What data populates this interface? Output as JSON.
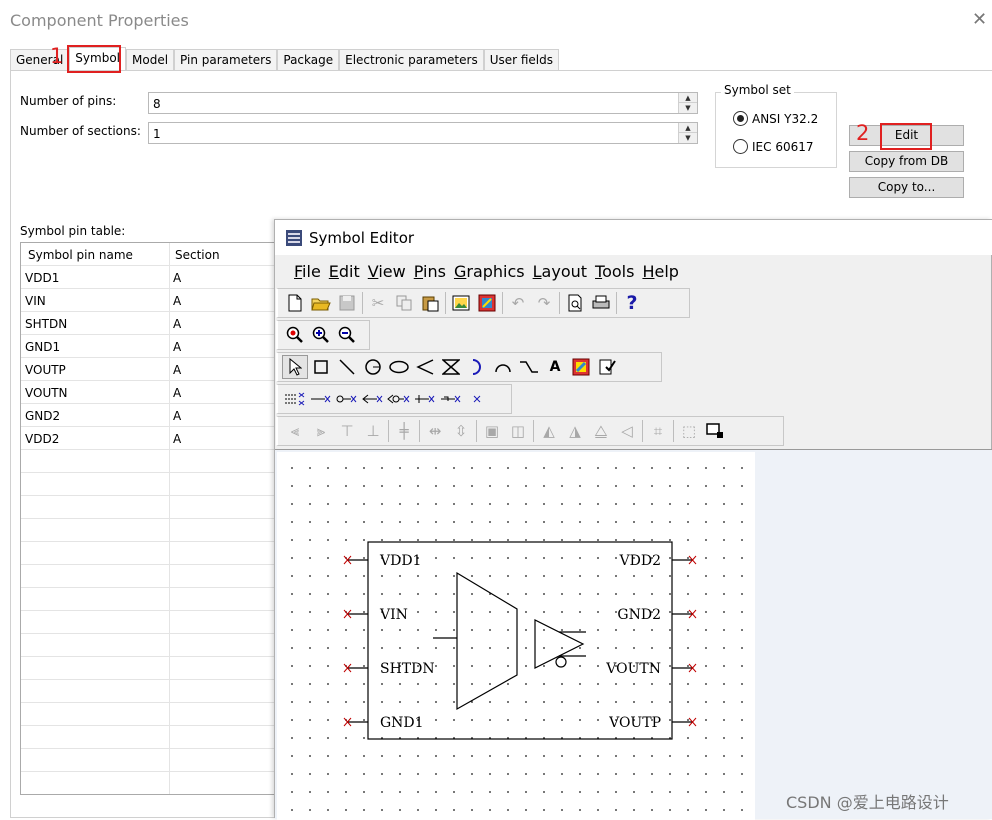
{
  "dialog": {
    "title": "Component Properties",
    "close": "✕",
    "tabs": [
      "General",
      "Symbol",
      "Model",
      "Pin parameters",
      "Package",
      "Electronic parameters",
      "User fields"
    ],
    "number_of_pins_label": "Number of pins:",
    "number_of_pins_value": "8",
    "number_of_sections_label": "Number of sections:",
    "number_of_sections_value": "1",
    "symbol_set": {
      "title": "Symbol set",
      "options": [
        "ANSI Y32.2",
        "IEC 60617"
      ],
      "selected": "ANSI Y32.2"
    },
    "buttons": {
      "edit": "Edit",
      "copy_from_db": "Copy from DB",
      "copy_to": "Copy to..."
    },
    "annotations": {
      "step1": "1",
      "step2": "2",
      "highlight_color": "#e02020"
    },
    "pin_table": {
      "label": "Symbol pin table:",
      "columns": [
        "Symbol pin name",
        "Section"
      ],
      "rows": [
        [
          "VDD1",
          "A"
        ],
        [
          "VIN",
          "A"
        ],
        [
          "SHTDN",
          "A"
        ],
        [
          "GND1",
          "A"
        ],
        [
          "VOUTP",
          "A"
        ],
        [
          "VOUTN",
          "A"
        ],
        [
          "GND2",
          "A"
        ],
        [
          "VDD2",
          "A"
        ]
      ]
    }
  },
  "symbol_editor": {
    "title": "Symbol Editor",
    "menu": [
      {
        "label": "File",
        "key": "F",
        "rest": "ile"
      },
      {
        "label": "Edit",
        "key": "E",
        "rest": "dit"
      },
      {
        "label": "View",
        "key": "V",
        "rest": "iew"
      },
      {
        "label": "Pins",
        "key": "P",
        "rest": "ins"
      },
      {
        "label": "Graphics",
        "key": "G",
        "rest": "raphics"
      },
      {
        "label": "Layout",
        "key": "L",
        "rest": "ayout"
      },
      {
        "label": "Tools",
        "key": "T",
        "rest": "ools"
      },
      {
        "label": "Help",
        "key": "H",
        "rest": "elp"
      }
    ],
    "icons": {
      "row1": [
        "new-file-icon",
        "open-folder-icon",
        "save-icon",
        "cut-icon",
        "copy-icon",
        "paste-icon",
        "import-image-icon",
        "properties-icon",
        "undo-icon",
        "redo-icon",
        "print-preview-icon",
        "print-icon",
        "help-icon"
      ],
      "row2": [
        "zoom-area-icon",
        "zoom-in-icon",
        "zoom-out-icon"
      ],
      "row3": [
        "select-arrow-icon",
        "rectangle-icon",
        "line-icon",
        "circle-icon",
        "ellipse-icon",
        "polyline-icon",
        "bezier-icon",
        "arc-ccw-icon",
        "arc-icon",
        "wire-icon",
        "text-icon",
        "picture-icon",
        "checklist-icon"
      ],
      "row4": [
        "pin-array-icon",
        "pin-line-icon",
        "pin-dot-icon",
        "pin-clock-icon",
        "pin-dotclock-icon",
        "pin-input-icon",
        "pin-output-icon",
        "pin-x-icon"
      ],
      "row5": [
        "align-left-icon",
        "align-right-icon",
        "align-top-icon",
        "align-bottom-icon",
        "align-center-icon",
        "space-horizontal-icon",
        "space-vertical-icon",
        "bring-front-icon",
        "send-back-icon",
        "flip-horizontal-icon",
        "flip-vertical-icon",
        "mirror-icon",
        "rotate-icon",
        "group-icon",
        "ungroup-icon",
        "drawing-area-icon"
      ]
    },
    "symbol": {
      "left_pins": [
        "VDD1",
        "VIN",
        "SHTDN",
        "GND1"
      ],
      "right_pins": [
        "VDD2",
        "GND2",
        "VOUTN",
        "VOUTP"
      ],
      "pin_marker_color": "#c00000"
    }
  },
  "watermark": "CSDN @爱上电路设计"
}
